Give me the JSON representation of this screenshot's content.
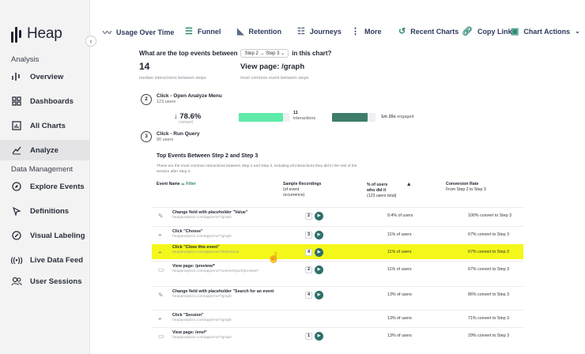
{
  "app": {
    "name": "Heap"
  },
  "sidebar": {
    "analysis_label": "Analysis",
    "data_mgmt_label": "Data Management",
    "items": [
      {
        "label": "Overview",
        "icon": "overview-icon"
      },
      {
        "label": "Dashboards",
        "icon": "dashboards-icon"
      },
      {
        "label": "All Charts",
        "icon": "all-charts-icon"
      },
      {
        "label": "Analyze",
        "icon": "analyze-icon",
        "active": true
      },
      {
        "label": "Explore Events",
        "icon": "explore-icon"
      },
      {
        "label": "Definitions",
        "icon": "definitions-icon"
      },
      {
        "label": "Visual Labeling",
        "icon": "visual-labeling-icon"
      },
      {
        "label": "Live Data Feed",
        "icon": "live-feed-icon"
      },
      {
        "label": "User Sessions",
        "icon": "user-sessions-icon"
      }
    ]
  },
  "toolbar": {
    "usage_over_time": "Usage Over Time",
    "funnel": "Funnel",
    "retention": "Retention",
    "journeys": "Journeys",
    "more": "More",
    "recent_charts": "Recent Charts",
    "copy_link": "Copy Link",
    "chart_actions": "Chart Actions"
  },
  "main": {
    "question_prefix": "What are the top events between",
    "question_select": "Step 2 → Step 3 ⌄",
    "question_suffix": "in this chart?",
    "median_value": "14",
    "median_caption": "median interactions between steps",
    "top_event": "View page: /graph",
    "top_event_caption": "most common event between steps",
    "step2": {
      "num": "2",
      "title": "Click - Open Analyze Menu",
      "users": "123 users"
    },
    "step3": {
      "num": "3",
      "title": "Click - Run Query",
      "users": "90 users"
    },
    "convert_pct": "↓ 78.6%",
    "convert_label": "convert",
    "interactions_num": "11",
    "interactions_label": "interactions",
    "engaged": "1m 20s",
    "engaged_label": "engaged",
    "section_title": "Top Events Between Step 2 and Step 3",
    "section_desc": "These are the most common interactions between Step 2 and Step 3, including all interactions they did in the rest of the session after Step 2.",
    "col_event": "Event Name",
    "col_filter": "Filter",
    "col_recordings_1": "Sample Recordings",
    "col_recordings_2": "(of event",
    "col_recordings_3": "occurrence)",
    "col_users_1": "% of users",
    "col_users_2": "who did it",
    "col_users_3": "(123 users total)",
    "col_conv_1": "Conversion Rate",
    "col_conv_2": "From Step 2 to Step 3",
    "colors": {
      "accent": "#2f8a74",
      "bar_light": "#5eeaa8",
      "bar_dark": "#3f7d6b",
      "highlight": "#f4f81a"
    }
  },
  "rows": [
    {
      "icon": "pencil-icon",
      "name": "Change field with placeholder \"Value\"",
      "url": "heapanalytics.com/app/env/*/graph",
      "rec": "2",
      "users": "9.4% of users",
      "conv": "100% convert to Step 3"
    },
    {
      "icon": "click-icon",
      "name": "Click \"Choose\"",
      "url": "heapanalytics.com/app/env/*/graph",
      "rec": "3",
      "users": "11% of users",
      "conv": "67% convert to Step 3"
    },
    {
      "icon": "click-icon",
      "name": "Click \"Close this event\"",
      "url": "heapanalytics.com/app/env/*/definitions",
      "rec": "4",
      "users": "11% of users",
      "conv": "67% convert to Step 3",
      "highlight": true
    },
    {
      "icon": "page-icon",
      "name": "View page: /preview/*",
      "url": "heapanalytics.com/app/env/*/users/report/preview/*",
      "rec": "2",
      "users": "11% of users",
      "conv": "67% convert to Step 3"
    },
    {
      "icon": "pencil-icon",
      "name": "Change field with placeholder \"Search for an event",
      "url": "heapanalytics.com/app/env/*/graph",
      "rec": "4",
      "users": "13% of users",
      "conv": "86% convert to Step 3"
    },
    {
      "icon": "click-icon",
      "name": "Click \"Session\"",
      "url": "heapanalytics.com/app/env/*/graph",
      "rec": "",
      "users": "13% of users",
      "conv": "71% convert to Step 3"
    },
    {
      "icon": "page-icon",
      "name": "View page: /env/*",
      "url": "heapanalytics.com/app/env/*/graph",
      "rec": "1",
      "users": "13% of users",
      "conv": "29% convert to Step 3"
    }
  ]
}
